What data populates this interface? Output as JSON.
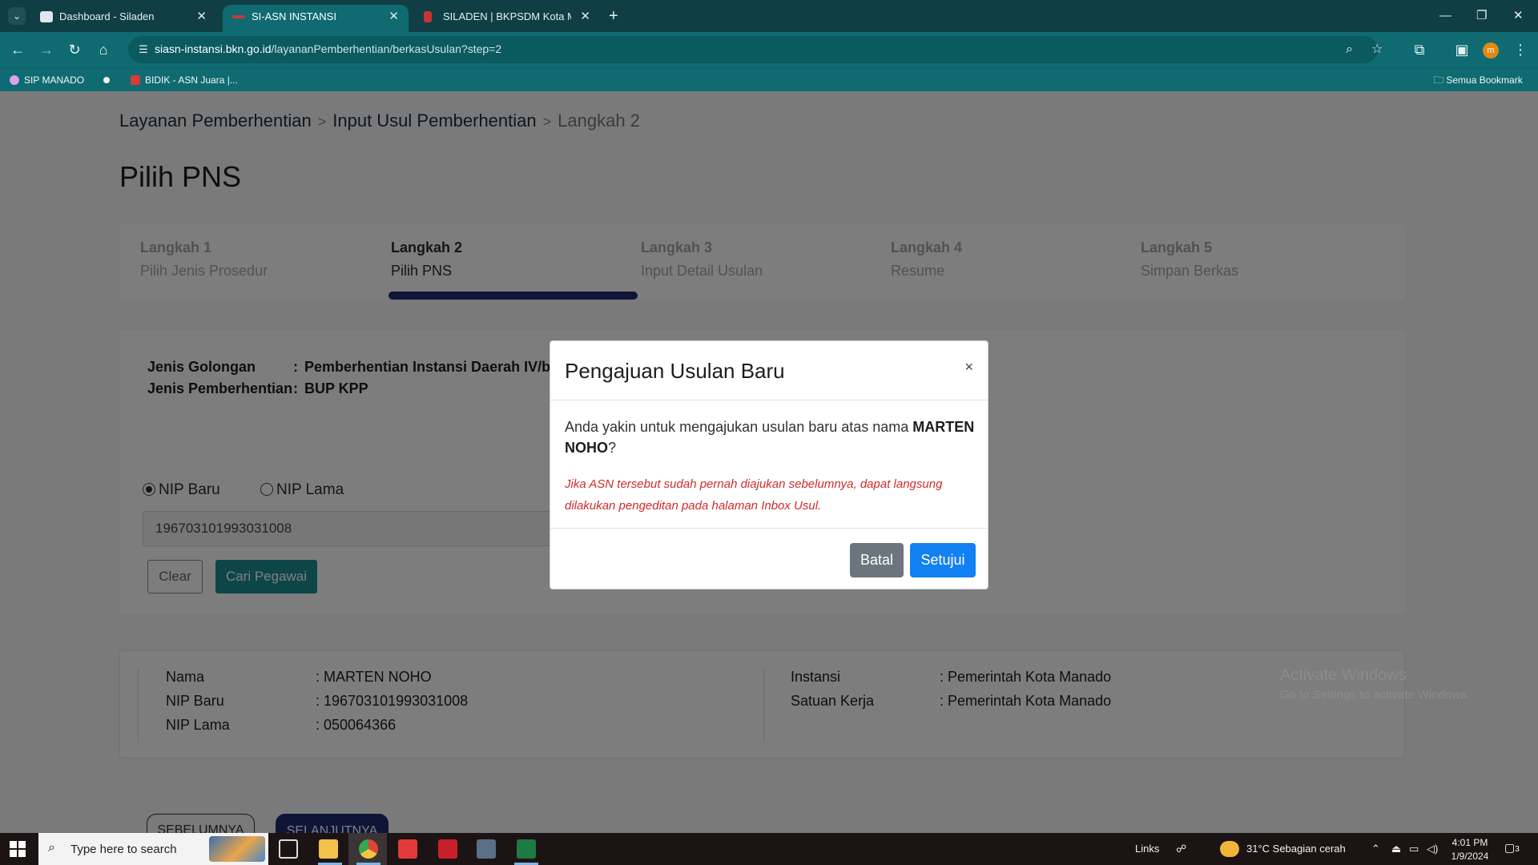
{
  "browser": {
    "tabs": [
      {
        "title": "Dashboard - Siladen",
        "active": false
      },
      {
        "title": "SI-ASN INSTANSI",
        "active": true
      },
      {
        "title": "SILADEN | BKPSDM Kota Manado",
        "active": false
      }
    ],
    "url_host": "siasn-instansi.bkn.go.id",
    "url_path": "/layananPemberhentian/berkasUsulan?step=2",
    "bookmarks": [
      "SIP MANADO",
      "BIDIK - ASN Juara |..."
    ],
    "all_bookmarks": "Semua Bookmark",
    "profile_initial": "m"
  },
  "breadcrumb": {
    "item1": "Layanan Pemberhentian",
    "item2": "Input Usul Pemberhentian",
    "item3": "Langkah 2",
    "separator": ">"
  },
  "page_title": "Pilih PNS",
  "steps": [
    {
      "num": "Langkah 1",
      "label": "Pilih Jenis Prosedur"
    },
    {
      "num": "Langkah 2",
      "label": "Pilih PNS"
    },
    {
      "num": "Langkah 3",
      "label": "Input Detail Usulan"
    },
    {
      "num": "Langkah 4",
      "label": "Resume"
    },
    {
      "num": "Langkah 5",
      "label": "Simpan Berkas"
    }
  ],
  "info": {
    "golongan_label": "Jenis Golongan",
    "golongan_value": "Pemberhentian Instansi Daerah IV/b l",
    "pemberhentian_label": "Jenis Pemberhentian",
    "pemberhentian_value": "BUP KPP",
    "colon": ":"
  },
  "search": {
    "radio_new": "NIP Baru",
    "radio_old": "NIP Lama",
    "nip_value": "196703101993031008",
    "clear_label": "Clear",
    "search_label": "Cari Pegawai"
  },
  "employee": {
    "nama_label": "Nama",
    "nama_value": ": MARTEN NOHO",
    "nip_baru_label": "NIP Baru",
    "nip_baru_value": ": 196703101993031008",
    "nip_lama_label": "NIP Lama",
    "nip_lama_value": ": 050064366",
    "instansi_label": "Instansi",
    "instansi_value": ": Pemerintah Kota Manado",
    "satker_label": "Satuan Kerja",
    "satker_value": ": Pemerintah Kota Manado"
  },
  "nav_buttons": {
    "prev": "SEBELUMNYA",
    "next": "SELANJUTNYA"
  },
  "modal": {
    "title": "Pengajuan Usulan Baru",
    "close": "×",
    "message_prefix": "Anda yakin untuk mengajukan usulan baru atas nama ",
    "message_name": "MARTEN NOHO",
    "message_suffix": "?",
    "warning": "Jika ASN tersebut sudah pernah diajukan sebelumnya, dapat langsung dilakukan pengeditan pada halaman Inbox Usul.",
    "cancel_label": "Batal",
    "confirm_label": "Setujui"
  },
  "watermark": {
    "line1": "Activate Windows",
    "line2": "Go to Settings to activate Windows."
  },
  "taskbar": {
    "search_placeholder": "Type here to search",
    "links": "Links",
    "weather": "31°C  Sebagian cerah",
    "time": "4:01 PM",
    "date": "1/9/2024",
    "notifications": "3"
  },
  "colors": {
    "accent_teal": "#0f6b71",
    "step_bar": "#1e2a6e",
    "confirm_blue": "#1181f2",
    "cancel_gray": "#6c757d",
    "warning_red": "#d02b2b"
  }
}
